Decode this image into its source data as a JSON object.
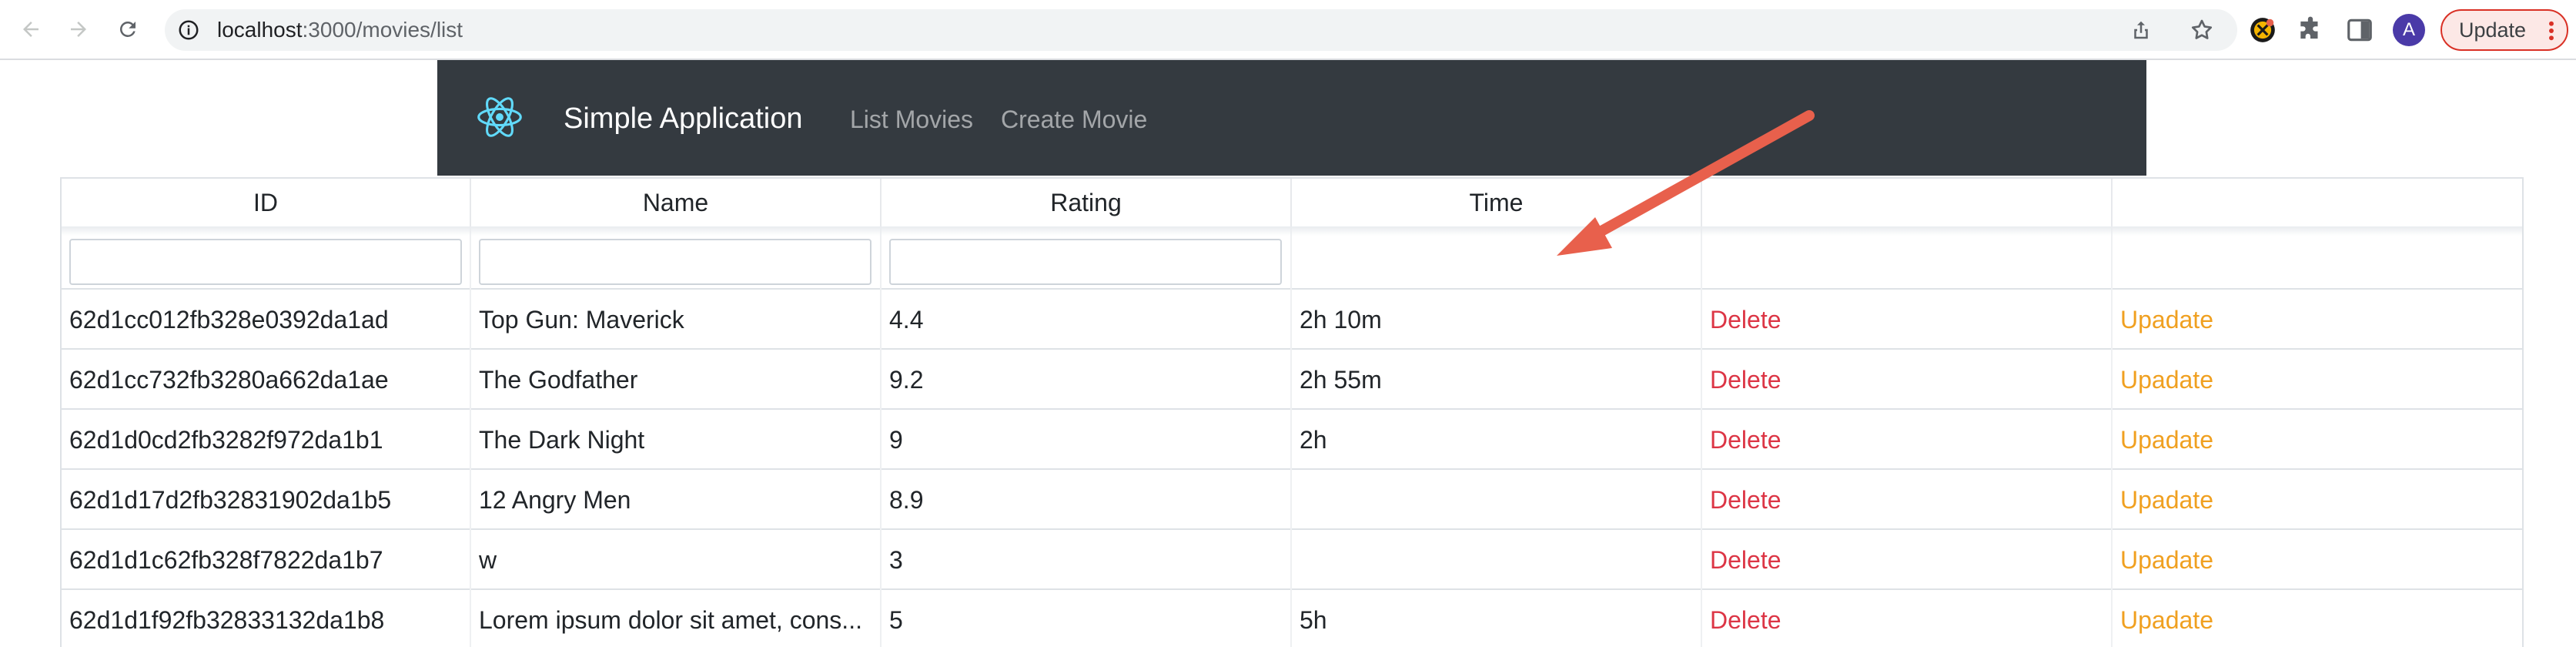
{
  "browser": {
    "url_host": "localhost",
    "url_path": ":3000/movies/list",
    "avatar_letter": "A",
    "update_label": "Update"
  },
  "navbar": {
    "brand": "Simple Application",
    "links": [
      "List Movies",
      "Create Movie"
    ]
  },
  "table": {
    "columns": [
      "ID",
      "Name",
      "Rating",
      "Time",
      "",
      ""
    ],
    "filters": [
      {
        "value": "",
        "placeholder": ""
      },
      {
        "value": "",
        "placeholder": ""
      },
      {
        "value": "",
        "placeholder": ""
      }
    ],
    "rows": [
      {
        "id": "62d1cc012fb328e0392da1ad",
        "name": "Top Gun: Maverick",
        "rating": "4.4",
        "time": "2h 10m",
        "delete": "Delete",
        "update": "Upadate"
      },
      {
        "id": "62d1cc732fb3280a662da1ae",
        "name": "The Godfather",
        "rating": "9.2",
        "time": "2h 55m",
        "delete": "Delete",
        "update": "Upadate"
      },
      {
        "id": "62d1d0cd2fb3282f972da1b1",
        "name": "The Dark Night",
        "rating": "9",
        "time": "2h",
        "delete": "Delete",
        "update": "Upadate"
      },
      {
        "id": "62d1d17d2fb32831902da1b5",
        "name": "12 Angry Men",
        "rating": "8.9",
        "time": "",
        "delete": "Delete",
        "update": "Upadate"
      },
      {
        "id": "62d1d1c62fb328f7822da1b7",
        "name": "w",
        "rating": "3",
        "time": "",
        "delete": "Delete",
        "update": "Upadate"
      },
      {
        "id": "62d1d1f92fb32833132da1b8",
        "name": "Lorem ipsum dolor sit amet, cons...",
        "rating": "5",
        "time": "5h",
        "delete": "Delete",
        "update": "Upadate"
      }
    ]
  },
  "colors": {
    "navbar_bg": "#343a40",
    "delete_text": "#dc3545",
    "update_text": "#f0a020",
    "annotation_arrow": "#e8604c",
    "react_logo": "#61dafb"
  },
  "icons": [
    "back-icon",
    "forward-icon",
    "reload-icon",
    "info-icon",
    "share-icon",
    "star-icon",
    "extension-icon",
    "puzzle-icon",
    "sidepanel-icon",
    "kebab-icon",
    "react-logo-icon"
  ]
}
